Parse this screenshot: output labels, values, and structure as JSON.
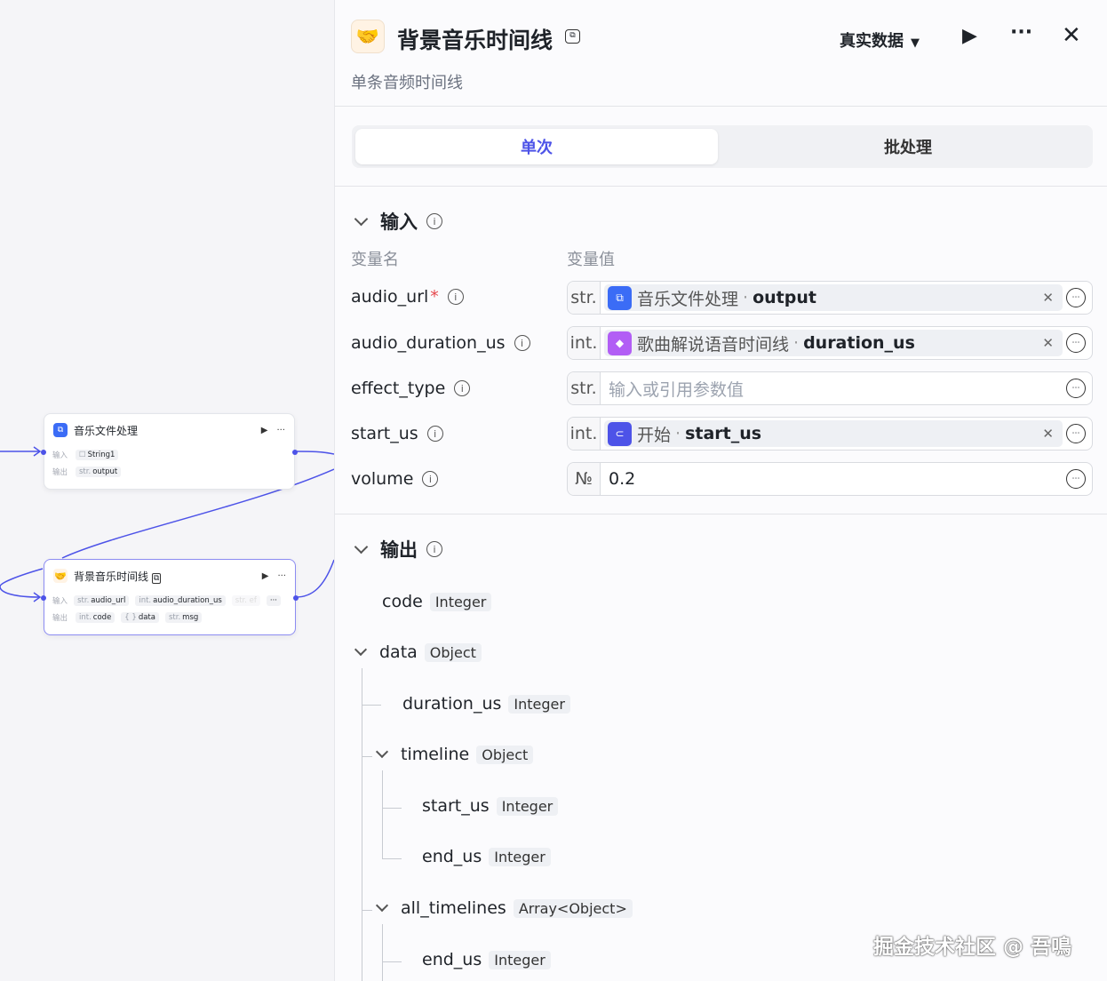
{
  "canvas": {
    "node1": {
      "title": "音乐文件处理",
      "input_label": "输入",
      "output_label": "输出",
      "inputs": [
        {
          "type": "",
          "name": "String1"
        }
      ],
      "outputs": [
        {
          "type": "str.",
          "name": "output"
        }
      ]
    },
    "node2": {
      "title": "背景音乐时间线",
      "input_label": "输入",
      "output_label": "输出",
      "inputs": [
        {
          "type": "str.",
          "name": "audio_url"
        },
        {
          "type": "int.",
          "name": "audio_duration_us"
        },
        {
          "type": "",
          "name": "str. ef"
        }
      ],
      "outputs": [
        {
          "type": "int.",
          "name": "code"
        },
        {
          "type": "{ }",
          "name": "data"
        },
        {
          "type": "str.",
          "name": "msg"
        }
      ]
    }
  },
  "panel": {
    "title": "背景音乐时间线",
    "description": "单条音频时间线",
    "data_mode": "真实数据",
    "tabs": {
      "single": "单次",
      "batch": "批处理"
    }
  },
  "input_section": {
    "title": "输入",
    "col_name": "变量名",
    "col_value": "变量值",
    "rows": [
      {
        "name": "audio_url",
        "type": "str.",
        "source": "音乐文件处理",
        "field": "output"
      },
      {
        "name": "audio_duration_us",
        "type": "int.",
        "source": "歌曲解说语音时间线",
        "field": "duration_us"
      },
      {
        "name": "effect_type",
        "type": "str.",
        "placeholder": "输入或引用参数值"
      },
      {
        "name": "start_us",
        "type": "int.",
        "source": "开始",
        "field": "start_us"
      },
      {
        "name": "volume",
        "type": "№",
        "value": "0.2"
      }
    ]
  },
  "output_section": {
    "title": "输出",
    "items": [
      {
        "name": "code",
        "type": "Integer"
      },
      {
        "name": "data",
        "type": "Object"
      },
      {
        "name": "duration_us",
        "type": "Integer"
      },
      {
        "name": "timeline",
        "type": "Object"
      },
      {
        "name": "start_us",
        "type": "Integer"
      },
      {
        "name": "end_us",
        "type": "Integer"
      },
      {
        "name": "all_timelines",
        "type": "Array<Object>"
      },
      {
        "name": "end_us",
        "type": "Integer"
      }
    ]
  },
  "watermark": "掘金技术社区 @ 吾鳴"
}
